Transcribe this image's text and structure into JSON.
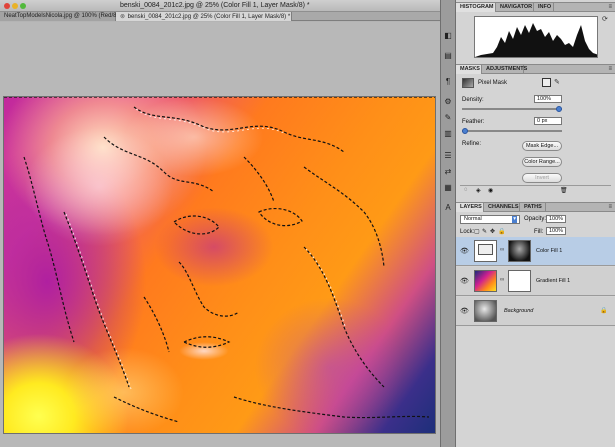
{
  "window": {
    "title": "benski_0084_201c2.jpg @ 25% (Color Fill 1, Layer Mask/8) *"
  },
  "document_tabs": [
    {
      "label": "NeatTopModelsNicola.jpg @ 100% (Red/8) *"
    },
    {
      "label": "benski_0084_201c2.jpg @ 25% (Color Fill 1, Layer Mask/8) *"
    }
  ],
  "panels": {
    "top_tabs": [
      "HISTOGRAM",
      "NAVIGATOR",
      "INFO"
    ],
    "mask_tabs": [
      "MASKS",
      "ADJUSTMENTS"
    ],
    "layer_tabs": [
      "LAYERS",
      "CHANNELS",
      "PATHS"
    ]
  },
  "masks": {
    "mask_type": "Pixel Mask",
    "density_label": "Density:",
    "density_value": "100%",
    "density_level": 1.0,
    "feather_label": "Feather:",
    "feather_value": "0 px",
    "feather_level": 0.0,
    "refine_label": "Refine:",
    "mask_edge_button": "Mask Edge...",
    "color_range_button": "Color Range...",
    "invert_button": "Invert"
  },
  "layers": {
    "blend_mode": "Normal",
    "opacity_label": "Opacity:",
    "opacity_value": "100%",
    "lock_label": "Lock:",
    "fill_label": "Fill:",
    "fill_value": "100%",
    "items": [
      {
        "name": "Color Fill 1",
        "selected": true
      },
      {
        "name": "Gradient Fill 1",
        "selected": false
      },
      {
        "name": "Background",
        "selected": false
      }
    ]
  },
  "icons": {
    "dock": [
      "histogram-icon",
      "adjust-icon",
      "brush-icon",
      "stamp-icon",
      "layers-icon",
      "clone-icon",
      "tool-presets-icon",
      "character-icon"
    ]
  }
}
